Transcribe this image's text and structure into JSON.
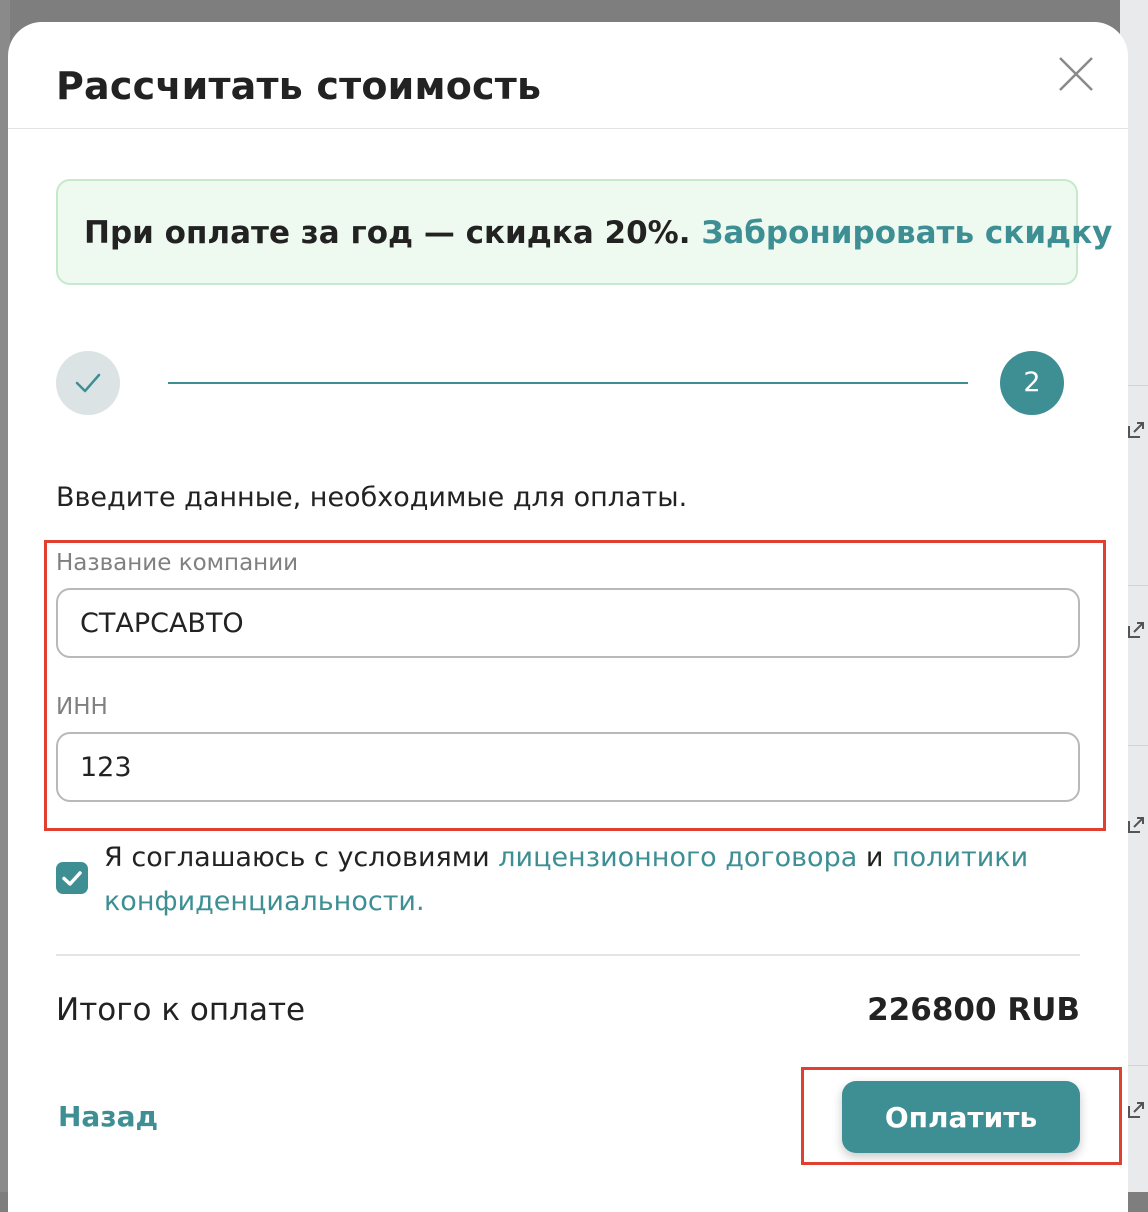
{
  "modal": {
    "title": "Рассчитать стоимость"
  },
  "promo": {
    "text": "При оплате за год — скидка 20%.",
    "link": "Забронировать скидку"
  },
  "stepper": {
    "step1_state": "done",
    "step2_label": "2"
  },
  "form": {
    "instructions": "Введите данные, необходимые для оплаты.",
    "company_label": "Название компании",
    "company_value": "СТАРСАВТО",
    "inn_label": "ИНН",
    "inn_value": "123"
  },
  "agreement": {
    "checked": true,
    "text_before": "Я соглашаюсь с условиями",
    "license_link": "лицензионного договора",
    "conjunction": "и",
    "privacy_link": "политики конфиденциальности."
  },
  "total": {
    "label": "Итого к оплате",
    "value": "226800 RUB"
  },
  "actions": {
    "back_label": "Назад",
    "pay_label": "Оплатить"
  },
  "colors": {
    "accent": "#3d8f94",
    "highlight": "#e0402f",
    "promo_bg": "#eefaf0"
  },
  "icons": {
    "close": "close-icon",
    "checkmark": "checkmark-icon",
    "external": "external-link-icon"
  }
}
